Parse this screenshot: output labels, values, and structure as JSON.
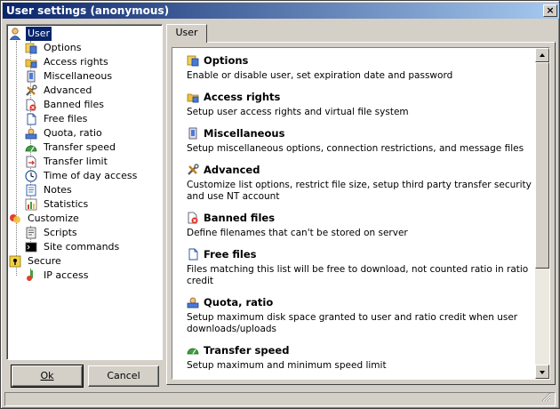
{
  "window": {
    "title": "User settings (anonymous)",
    "close_label": "×"
  },
  "tree": [
    {
      "label": "User",
      "icon": "user-icon",
      "selected": true
    },
    {
      "label": "Options",
      "icon": "options-icon"
    },
    {
      "label": "Access rights",
      "icon": "access-rights-icon"
    },
    {
      "label": "Miscellaneous",
      "icon": "miscellaneous-icon"
    },
    {
      "label": "Advanced",
      "icon": "advanced-tools-icon"
    },
    {
      "label": "Banned files",
      "icon": "banned-files-icon"
    },
    {
      "label": "Free files",
      "icon": "free-files-icon"
    },
    {
      "label": "Quota, ratio",
      "icon": "quota-icon"
    },
    {
      "label": "Transfer speed",
      "icon": "speed-gauge-icon"
    },
    {
      "label": "Transfer limit",
      "icon": "transfer-limit-icon"
    },
    {
      "label": "Time of day access",
      "icon": "clock-icon"
    },
    {
      "label": "Notes",
      "icon": "notes-icon"
    },
    {
      "label": "Statistics",
      "icon": "statistics-icon"
    },
    {
      "label": "Customize",
      "icon": "customize-icon"
    },
    {
      "label": "Scripts",
      "icon": "scripts-icon"
    },
    {
      "label": "Site commands",
      "icon": "site-commands-icon"
    },
    {
      "label": "Secure",
      "icon": "secure-key-icon"
    },
    {
      "label": "IP access",
      "icon": "ip-access-icon"
    }
  ],
  "buttons": {
    "ok": "Ok",
    "cancel": "Cancel"
  },
  "tab": {
    "label": "User"
  },
  "sections": [
    {
      "title": "Options",
      "icon": "options-icon",
      "desc": "Enable or disable user, set expiration date and password"
    },
    {
      "title": "Access rights",
      "icon": "access-rights-icon",
      "desc": "Setup user access rights and virtual file system"
    },
    {
      "title": "Miscellaneous",
      "icon": "miscellaneous-icon",
      "desc": "Setup miscellaneous options, connection restrictions, and message files"
    },
    {
      "title": "Advanced",
      "icon": "advanced-tools-icon",
      "desc": "Customize list options, restrict file size, setup third party transfer security and use NT account"
    },
    {
      "title": "Banned files",
      "icon": "banned-files-icon",
      "desc": "Define filenames that can't be stored on server"
    },
    {
      "title": "Free files",
      "icon": "free-files-icon",
      "desc": "Files matching this list will be free to download, not counted ratio in ratio credit"
    },
    {
      "title": "Quota, ratio",
      "icon": "quota-icon",
      "desc": "Setup maximum disk space granted to user and ratio credit when user downloads/uploads"
    },
    {
      "title": "Transfer speed",
      "icon": "speed-gauge-icon",
      "desc": "Setup maximum and minimum speed limit"
    }
  ]
}
